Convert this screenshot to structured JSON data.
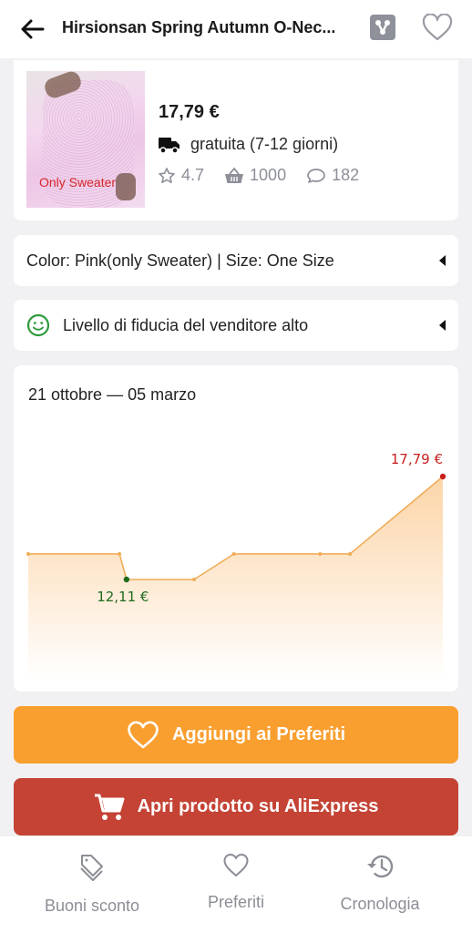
{
  "header": {
    "title": "Hirsionsan Spring Autumn O-Nec...",
    "back_icon": "arrow-left-icon",
    "share_icon": "share-icon",
    "favorite_icon": "heart-outline-icon"
  },
  "product": {
    "image_label": "Only Sweater",
    "price": "17,79 €",
    "shipping": "gratuita (7-12 giorni)",
    "rating": "4.7",
    "orders": "1000",
    "reviews": "182"
  },
  "variant": {
    "text": "Color: Pink(only Sweater) | Size: One Size"
  },
  "seller": {
    "trust_text": "Livello di fiducia del venditore alto"
  },
  "price_history": {
    "date_range": "21 ottobre — 05 marzo",
    "min_label": "12,11 €",
    "max_label": "17,79 €"
  },
  "chart_data": {
    "type": "area",
    "title": "21 ottobre — 05 marzo",
    "xlabel": "",
    "ylabel": "",
    "x": [
      0,
      1,
      2,
      3,
      4,
      5,
      6,
      7
    ],
    "values": [
      13.52,
      13.52,
      12.11,
      12.11,
      13.52,
      13.52,
      13.52,
      17.79
    ],
    "x_fraction": [
      0.0,
      0.22,
      0.237,
      0.4,
      0.496,
      0.704,
      0.776,
      1.0
    ],
    "min": {
      "index": 2,
      "value": 12.11,
      "label": "12,11 €"
    },
    "max": {
      "index": 7,
      "value": 17.79,
      "label": "17,79 €"
    },
    "grid": false,
    "colors": {
      "line": "#f0ad5a",
      "fill": "#fcd9b0",
      "min": "#1f6b1f",
      "max": "#c81e1e"
    }
  },
  "actions": {
    "favorite_label": "Aggiungi ai Preferiti",
    "open_label": "Apri prodotto su AliExpress"
  },
  "bottom_nav": [
    {
      "label": "Buoni sconto",
      "icon": "tag-icon"
    },
    {
      "label": "Preferiti",
      "icon": "heart-icon"
    },
    {
      "label": "Cronologia",
      "icon": "history-icon"
    }
  ],
  "colors": {
    "favorite_button": "#f99f30",
    "aliexpress_button": "#c44335",
    "trust_green": "#2e9b3c"
  }
}
